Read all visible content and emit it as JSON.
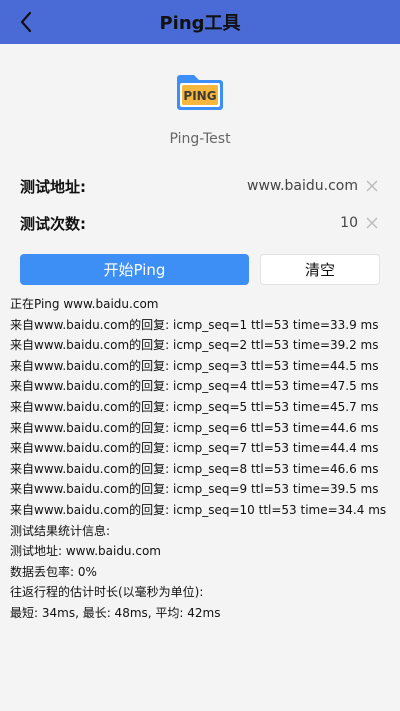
{
  "header": {
    "title": "Ping工具"
  },
  "logo": {
    "text": "PING"
  },
  "subtitle": "Ping-Test",
  "address": {
    "label": "测试地址:",
    "value": "www.baidu.com"
  },
  "count": {
    "label": "测试次数:",
    "value": "10"
  },
  "buttons": {
    "start": "开始Ping",
    "clear": "清空"
  },
  "log": [
    "正在Ping www.baidu.com",
    "来自www.baidu.com的回复:   icmp_seq=1 ttl=53 time=33.9 ms",
    "来自www.baidu.com的回复:   icmp_seq=2 ttl=53 time=39.2 ms",
    "来自www.baidu.com的回复:   icmp_seq=3 ttl=53 time=44.5 ms",
    "来自www.baidu.com的回复:   icmp_seq=4 ttl=53 time=47.5 ms",
    "来自www.baidu.com的回复:   icmp_seq=5 ttl=53 time=45.7 ms",
    "来自www.baidu.com的回复:   icmp_seq=6 ttl=53 time=44.6 ms",
    "来自www.baidu.com的回复:   icmp_seq=7 ttl=53 time=44.4 ms",
    "来自www.baidu.com的回复:   icmp_seq=8 ttl=53 time=46.6 ms",
    "来自www.baidu.com的回复:   icmp_seq=9 ttl=53 time=39.5 ms",
    "来自www.baidu.com的回复:   icmp_seq=10 ttl=53 time=34.4 ms",
    "测试结果统计信息:",
    "测试地址:  www.baidu.com",
    "数据丢包率:   0%",
    "往返行程的估计时长(以毫秒为单位):",
    "最短:  34ms, 最长:  48ms, 平均:  42ms"
  ],
  "colors": {
    "header": "#4a6bd6",
    "primary_button": "#3d8ff5",
    "logo_blue": "#3d8ff5",
    "logo_yellow": "#f6b73c"
  },
  "icons": {
    "back": "back-arrow-icon",
    "logo": "ping-folder-icon",
    "clear": "close-icon"
  }
}
